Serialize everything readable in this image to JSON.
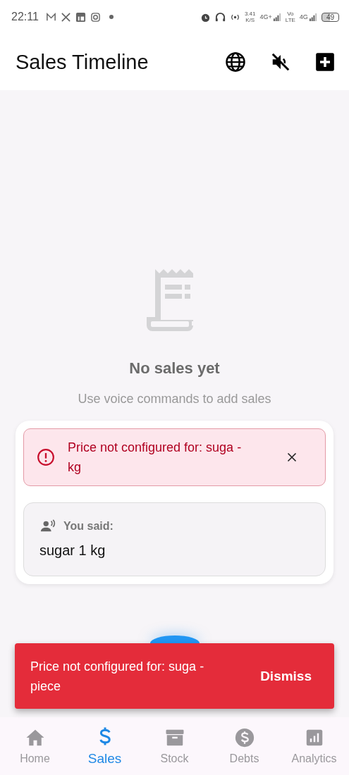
{
  "status_bar": {
    "time": "22:11",
    "speed": "3.41",
    "speed_unit": "K/S",
    "network_1": "4G+",
    "volte_top": "Vo",
    "volte_bottom": "LTE",
    "network_2": "4G",
    "battery": "49"
  },
  "app_bar": {
    "title": "Sales Timeline",
    "muted": true
  },
  "empty_state": {
    "title": "No sales yet",
    "subtitle": "Use voice commands to add sales"
  },
  "voice_panel": {
    "error": "Price not configured for: suga - kg",
    "heard_label": "You said:",
    "heard_text": "sugar 1 kg"
  },
  "snackbar": {
    "message": "Price not configured for: suga - piece",
    "action": "Dismiss"
  },
  "bottom_nav": [
    {
      "label": "Home",
      "selected": false
    },
    {
      "label": "Sales",
      "selected": true
    },
    {
      "label": "Stock",
      "selected": false
    },
    {
      "label": "Debts",
      "selected": false
    },
    {
      "label": "Analytics",
      "selected": false
    }
  ]
}
